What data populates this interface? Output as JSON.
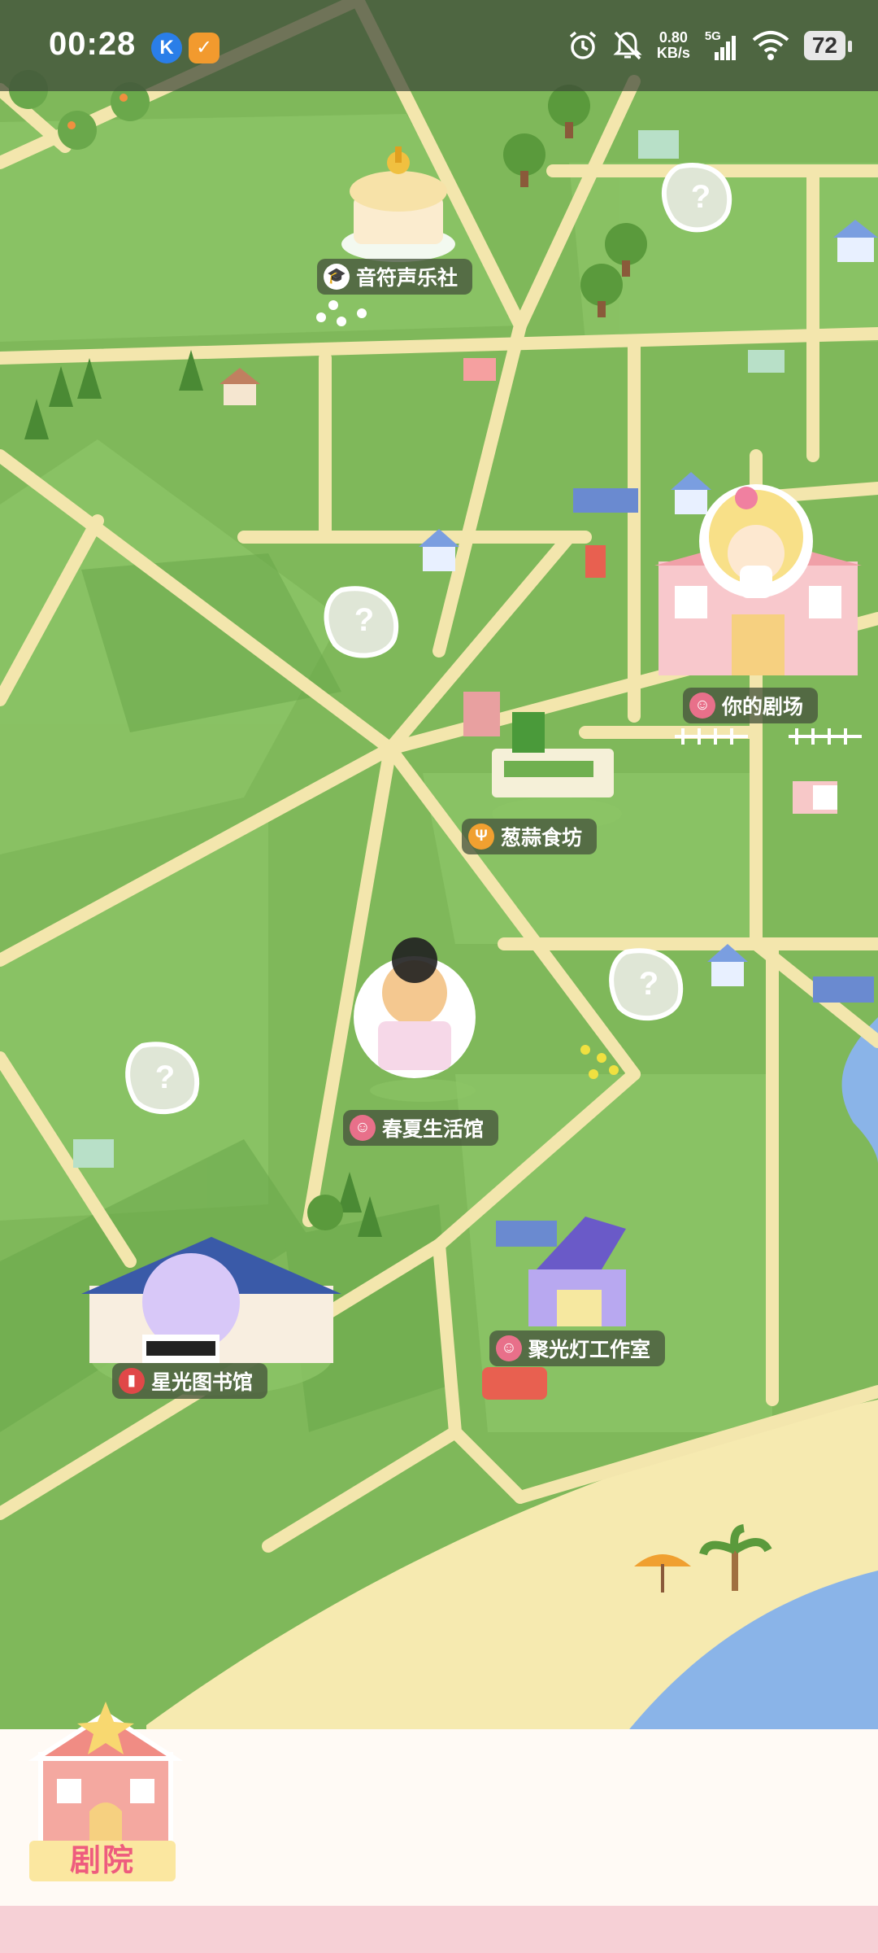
{
  "status_bar": {
    "time": "00:28",
    "app_icon_1": "K",
    "network_speed_value": "0.80",
    "network_speed_unit": "KB/s",
    "network_type": "5G",
    "battery": "72",
    "icons": [
      "alarm-icon",
      "mute-icon",
      "signal-icon",
      "wifi-icon",
      "battery-icon"
    ]
  },
  "map": {
    "locations": [
      {
        "name": "音符声乐社",
        "icon": "graduation-cap-icon"
      },
      {
        "name": "你的剧场",
        "icon": "theater-mask-icon"
      },
      {
        "name": "葱蒜食坊",
        "icon": "fork-knife-icon"
      },
      {
        "name": "春夏生活馆",
        "icon": "theater-mask-icon"
      },
      {
        "name": "星光图书馆",
        "icon": "book-icon"
      },
      {
        "name": "聚光灯工作室",
        "icon": "theater-mask-icon"
      }
    ],
    "unknown_marker": "?",
    "colors": {
      "grass": "#7fb85a",
      "road": "#f3e6ad",
      "water": "#8ab4e8",
      "sand": "#f6eab0"
    }
  },
  "bottom_nav": {
    "tab_label": "剧院"
  }
}
